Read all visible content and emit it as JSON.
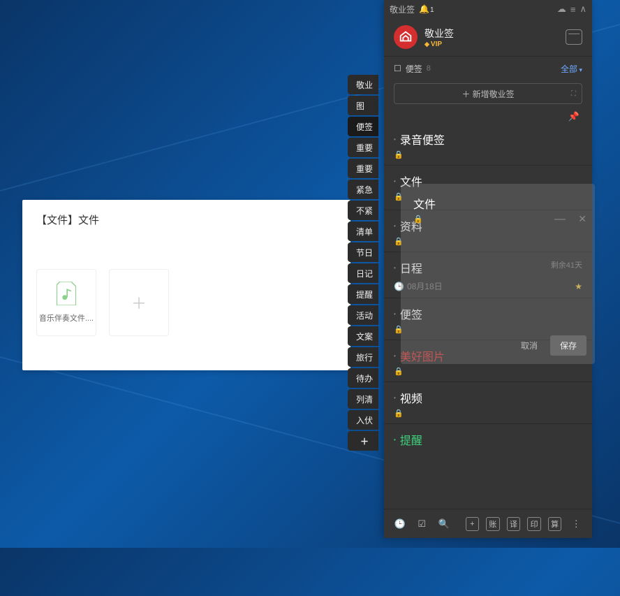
{
  "file_panel": {
    "title": "【文件】文件",
    "tile_label": "音乐伴奏文件...."
  },
  "tags": [
    "敬业",
    "图",
    "便签",
    "重要",
    "重要",
    "紧急",
    "不紧",
    "清单",
    "节日",
    "日记",
    "提醒",
    "活动",
    "文案",
    "旅行",
    "待办",
    "列清",
    "入伏"
  ],
  "titlebar": {
    "app": "敬业签",
    "notif_count": "1"
  },
  "brand": {
    "name": "敬业签",
    "vip": "VIP"
  },
  "section": {
    "label": "便签",
    "count": "8",
    "filter": "全部"
  },
  "add_button": "＋ 新增敬业签",
  "notes": [
    {
      "title": "录音便签"
    },
    {
      "title": "文件"
    },
    {
      "title": "资料"
    },
    {
      "title": "日程",
      "remaining": "剩余41天",
      "date": "08月18日",
      "star": true
    },
    {
      "title": "便签"
    },
    {
      "title": "美好图片",
      "red": true
    },
    {
      "title": "视频"
    },
    {
      "title": "提醒",
      "green": true
    }
  ],
  "edit_card": {
    "cancel": "取消",
    "save": "保存"
  },
  "bottombar": {
    "sq": [
      "+",
      "账",
      "译",
      "印",
      "算"
    ]
  }
}
